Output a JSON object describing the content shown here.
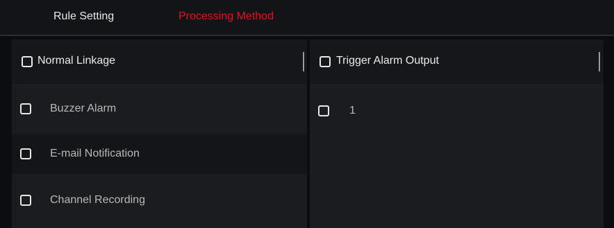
{
  "tabs": {
    "rule_setting": "Rule Setting",
    "processing_method": "Processing Method",
    "active_color": "#e0141c"
  },
  "left_panel": {
    "header_label": "Normal Linkage",
    "items": [
      {
        "label": "Buzzer Alarm",
        "checked": false
      },
      {
        "label": "E-mail Notification",
        "checked": false
      },
      {
        "label": "Channel Recording",
        "checked": false
      }
    ]
  },
  "right_panel": {
    "header_label": "Trigger Alarm Output",
    "items": [
      {
        "label": "1",
        "checked": false
      }
    ]
  }
}
